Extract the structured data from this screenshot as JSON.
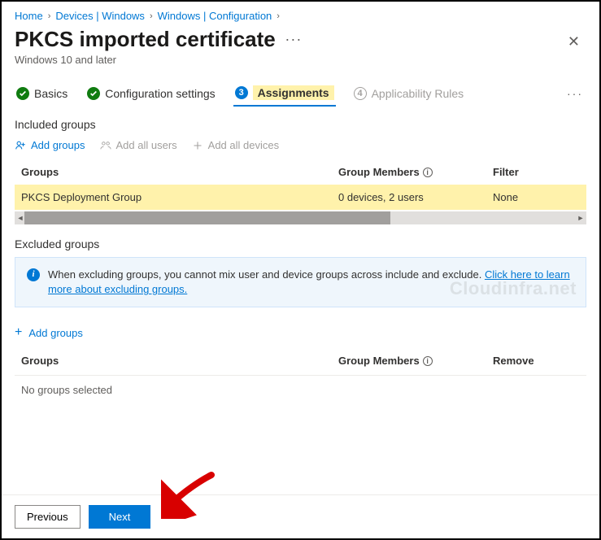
{
  "breadcrumb": {
    "items": [
      {
        "label": "Home"
      },
      {
        "label": "Devices | Windows"
      },
      {
        "label": "Windows | Configuration"
      }
    ]
  },
  "header": {
    "title": "PKCS imported certificate",
    "subtitle": "Windows 10 and later"
  },
  "tabs": {
    "basics": "Basics",
    "config": "Configuration settings",
    "assignments_num": "3",
    "assignments": "Assignments",
    "applicability_num": "4",
    "applicability": "Applicability Rules"
  },
  "included": {
    "section_title": "Included groups",
    "add_groups": "Add groups",
    "add_all_users": "Add all users",
    "add_all_devices": "Add all devices",
    "columns": {
      "groups": "Groups",
      "members": "Group Members",
      "filter": "Filter"
    },
    "rows": [
      {
        "group": "PKCS Deployment Group",
        "members": "0 devices, 2 users",
        "filter": "None"
      }
    ]
  },
  "excluded": {
    "section_title": "Excluded groups",
    "info_text": "When excluding groups, you cannot mix user and device groups across include and exclude. ",
    "info_link": "Click here to learn more about excluding groups.",
    "add_groups": "Add groups",
    "columns": {
      "groups": "Groups",
      "members": "Group Members",
      "remove": "Remove"
    },
    "empty": "No groups selected"
  },
  "footer": {
    "previous": "Previous",
    "next": "Next"
  },
  "watermark": "Cloudinfra.net"
}
